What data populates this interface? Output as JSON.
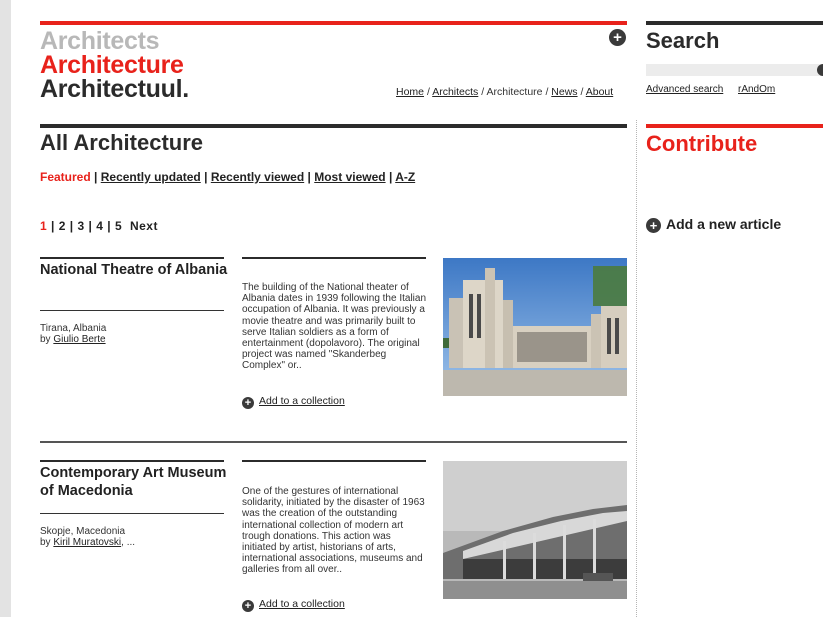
{
  "brand": {
    "line1": "Architects",
    "line2": "Architecture",
    "line3": "Architectuul.",
    "colors": {
      "accent": "#e8221b",
      "dark": "#2b2b2b",
      "muted": "#b8b8b8"
    }
  },
  "nav": {
    "home": "Home",
    "architects": "Architects",
    "architecture": "Architecture",
    "news": "News",
    "about": "About",
    "separator": "/"
  },
  "page": {
    "title": "All Architecture",
    "filters": {
      "featured": "Featured",
      "recently_updated": "Recently updated",
      "recently_viewed": "Recently viewed",
      "most_viewed": "Most viewed",
      "az": "A-Z",
      "separator": "|"
    },
    "pagination": {
      "pages": [
        "1",
        "2",
        "3",
        "4",
        "5"
      ],
      "current": "1",
      "next": "Next"
    }
  },
  "items": [
    {
      "title": "National Theatre of Albania",
      "location": "Tirana, Albania",
      "by_label": "by",
      "architect": "Giulio Berte",
      "architect_suffix": "",
      "description": "The building of the National theater of Albania dates in 1939 following the Italian occupation of Albania. It was previously a movie theatre and was primarily built to serve Italian soldiers as a form of entertainment (dopolavoro). The original project was named \"Skanderbeg Complex\" or..",
      "collection_label": "Add to a collection"
    },
    {
      "title": "Contemporary Art Museum of Macedonia",
      "location": "Skopje, Macedonia",
      "by_label": "by",
      "architect": "Kiril Muratovski",
      "architect_suffix": ", ...",
      "description": "One of the gestures of international solidarity, initiated by the disaster of 1963 was the creation of the outstanding international collection of modern art trough donations. This action was initiated by artist, historians of arts, international associations, museums and galleries from all over..",
      "collection_label": "Add to a collection"
    }
  ],
  "sidebar": {
    "search_title": "Search",
    "advanced_search": "Advanced search",
    "random": "rAndOm",
    "contribute_title": "Contribute",
    "add_article": "Add a new article"
  },
  "icons": {
    "plus": "+",
    "add_circle": "plus-circle-icon"
  }
}
